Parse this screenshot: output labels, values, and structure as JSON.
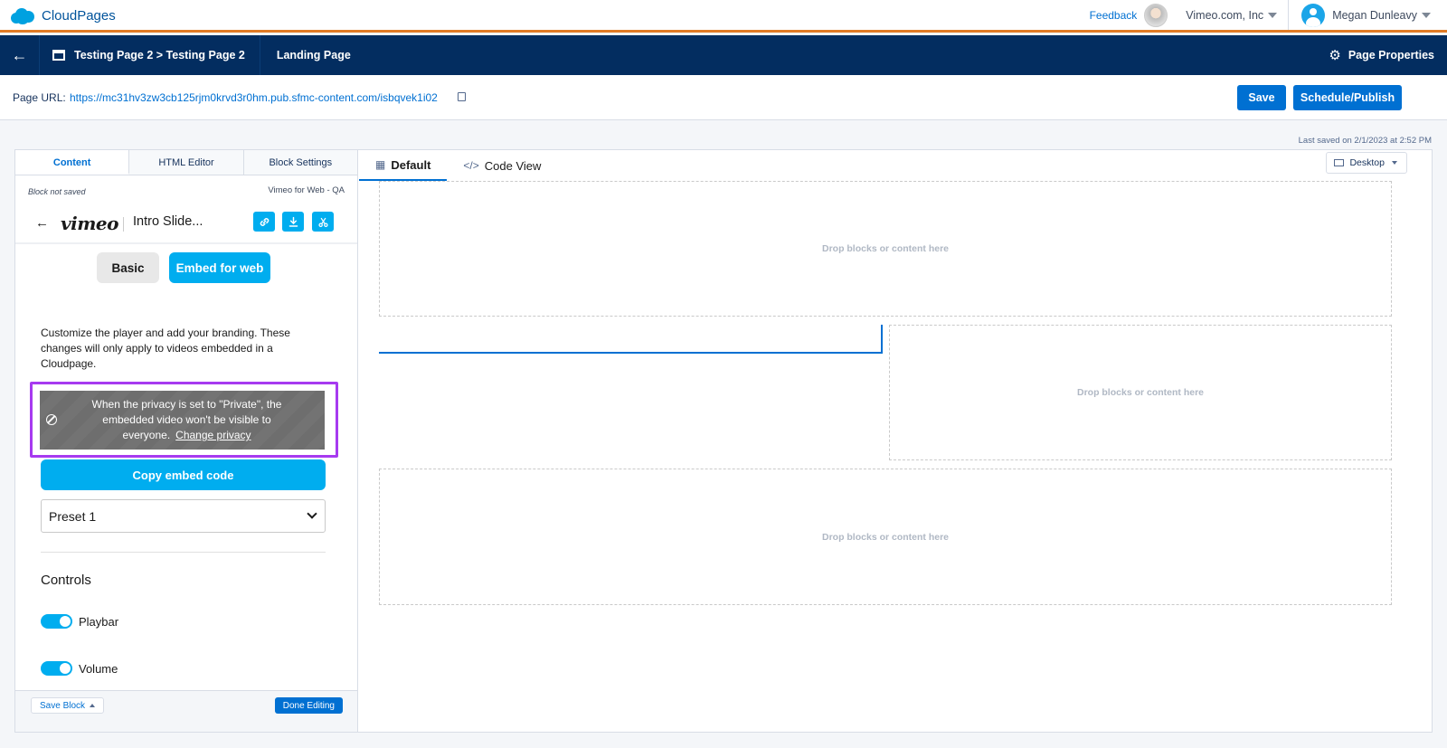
{
  "app": {
    "name": "CloudPages"
  },
  "topbar": {
    "feedback": "Feedback",
    "org": "Vimeo.com, Inc",
    "user": "Megan Dunleavy"
  },
  "nav": {
    "breadcrumb": "Testing Page 2 > Testing Page 2",
    "page_type": "Landing Page",
    "properties": "Page Properties"
  },
  "url_row": {
    "label": "Page URL:",
    "url": "https://mc31hv3zw3cb125rjm0krvd3r0hm.pub.sfmc-content.com/isbqvek1i02",
    "save": "Save",
    "publish": "Schedule/Publish",
    "last_saved": "Last saved on 2/1/2023 at 2:52 PM"
  },
  "left_panel": {
    "tabs": [
      "Content",
      "HTML Editor",
      "Block Settings"
    ],
    "block_status": "Block not saved",
    "block_app": "Vimeo for Web - QA",
    "vimeo": {
      "logo": "vimeo",
      "title": "Intro Slide...",
      "tab_basic": "Basic",
      "tab_embed": "Embed for web",
      "description": "Customize the player and add your branding. These changes will only apply to videos embedded in a Cloudpage.",
      "privacy_text": "When the privacy is set to \"Private\", the embedded video won't be visible to everyone.",
      "privacy_link": "Change privacy",
      "copy_button": "Copy embed code",
      "preset_value": "Preset 1",
      "controls_heading": "Controls",
      "toggles": [
        {
          "label": "Playbar",
          "on": true
        },
        {
          "label": "Volume",
          "on": true
        }
      ]
    },
    "footer": {
      "save_block": "Save Block",
      "done": "Done Editing"
    }
  },
  "canvas": {
    "tabs": [
      "Default",
      "Code View"
    ],
    "device": "Desktop",
    "drop_text": "Drop blocks or content here"
  },
  "colors": {
    "navy": "#032d60",
    "accent_orange": "#e07b26",
    "sf_blue": "#0070d2",
    "vimeo_blue": "#00adef",
    "highlight_purple": "#a73af0"
  },
  "icons": [
    "salesforce-cloud-icon",
    "back-arrow-icon",
    "page-icon",
    "gear-icon",
    "copy-icon",
    "link-icon",
    "download-icon",
    "cut-icon",
    "ban-icon",
    "chevron-down-icon",
    "layout-icon",
    "code-icon",
    "monitor-icon"
  ]
}
